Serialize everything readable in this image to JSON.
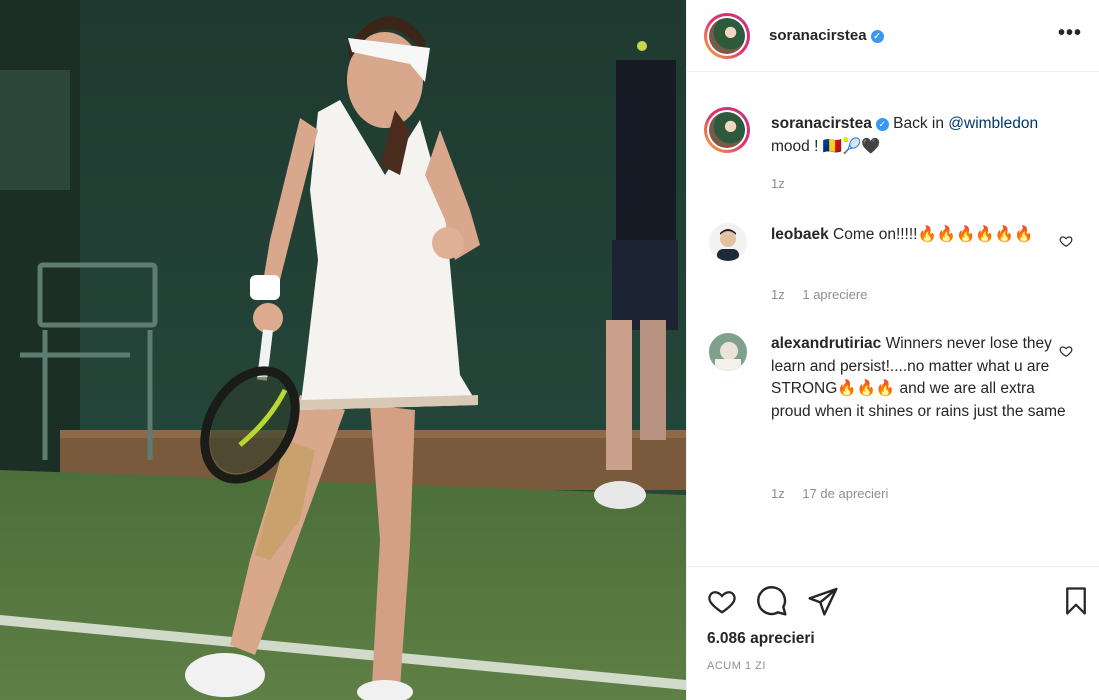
{
  "post": {
    "author": "soranacirstea",
    "verified": true,
    "more_icon": "more-horizontal-icon",
    "caption": {
      "username": "soranacirstea",
      "text_before": "Back in ",
      "mention": "@wimbledon",
      "text_after": "mood ! 🇷🇴🎾🖤",
      "time": "1z"
    },
    "comments": [
      {
        "username": "leobaek",
        "text": "Come on!!!!!🔥🔥🔥🔥🔥🔥",
        "time": "1z",
        "likes": "1 apreciere"
      },
      {
        "username": "alexandrutiriac",
        "text": "Winners never lose they learn and persist!....no matter what u are STRONG🔥🔥🔥 and we are all extra proud when it shines or rains just the same",
        "time": "1z",
        "likes": "17 de aprecieri"
      }
    ],
    "likes_count": "6.086 aprecieri",
    "posted_ago": "ACUM 1 ZI"
  },
  "colors": {
    "link": "#00376b",
    "verified": "#3897f0",
    "muted": "#8e8e8e",
    "text": "#262626"
  }
}
